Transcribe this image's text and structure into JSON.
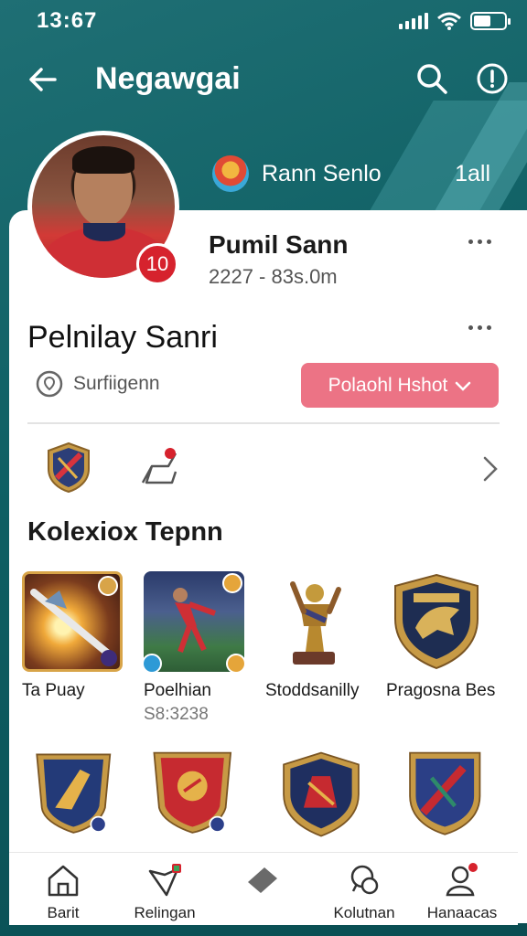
{
  "status_bar": {
    "time": "13:67"
  },
  "app_bar": {
    "title": "Negawgai"
  },
  "top_meta": {
    "name": "Rann Senlo",
    "count": "1all"
  },
  "profile": {
    "number": "10",
    "name": "Pumil Sann",
    "subtitle": "2227 - 83s.0m",
    "display_name": "Pelnilay Sanri",
    "location": "Surfiigenn",
    "primary_button": "Polaohl Hshot",
    "primary_button_color": "#ec7385"
  },
  "collection": {
    "title": "Kolexiox Tepnn",
    "items": [
      {
        "name": "Ta Puay",
        "value": "",
        "icon": "spear-card-icon"
      },
      {
        "name": "Poelhian",
        "value": "S8:3238",
        "icon": "player-card-icon"
      },
      {
        "name": "Stoddsanilly",
        "value": "",
        "icon": "trophy-statue-icon"
      },
      {
        "name": "Pragosna Bes",
        "value": "",
        "icon": "wolf-shield-icon"
      },
      {
        "name": "",
        "value": "",
        "icon": "blue-crest-icon"
      },
      {
        "name": "",
        "value": "",
        "icon": "red-crest-icon"
      },
      {
        "name": "",
        "value": "",
        "icon": "knight-crest-icon"
      },
      {
        "name": "",
        "value": "",
        "icon": "sword-crest-icon"
      }
    ]
  },
  "bottom_nav": [
    {
      "label": "Barit",
      "icon": "home-icon"
    },
    {
      "label": "Relingan",
      "icon": "shield-pin-icon"
    },
    {
      "label": "",
      "icon": "diamond-icon"
    },
    {
      "label": "Kolutnan",
      "icon": "chat-icon"
    },
    {
      "label": "Hanaacas",
      "icon": "profile-icon"
    }
  ]
}
